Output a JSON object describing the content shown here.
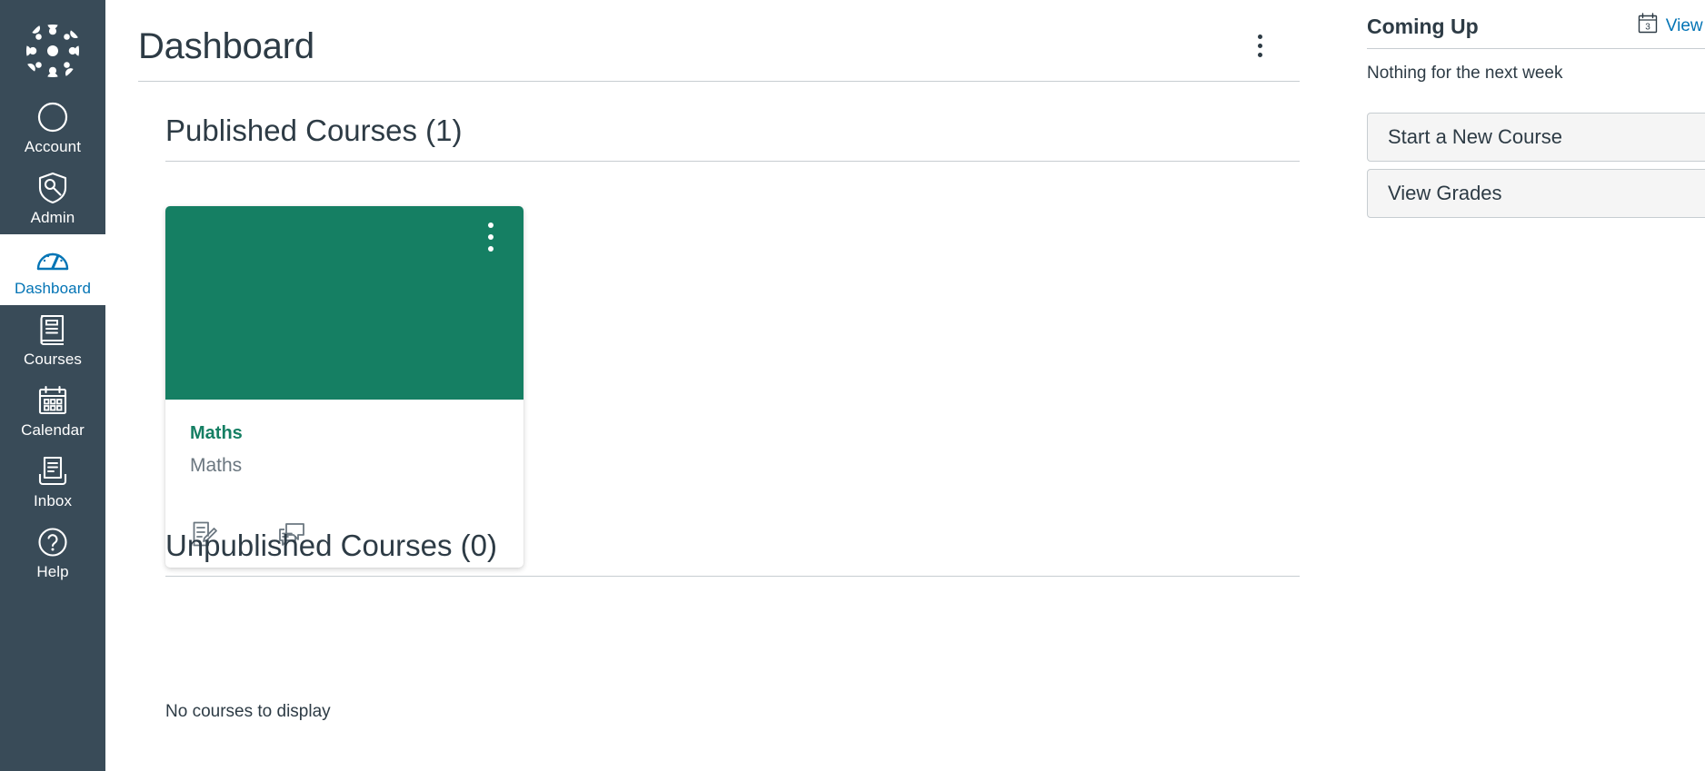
{
  "global_nav": {
    "logo_name": "canvas-logo",
    "items": [
      {
        "label": "Account",
        "icon": "user-circle-icon",
        "active": false
      },
      {
        "label": "Admin",
        "icon": "shield-key-icon",
        "active": false
      },
      {
        "label": "Dashboard",
        "icon": "dashboard-gauge-icon",
        "active": true
      },
      {
        "label": "Courses",
        "icon": "book-icon",
        "active": false
      },
      {
        "label": "Calendar",
        "icon": "calendar-icon",
        "active": false
      },
      {
        "label": "Inbox",
        "icon": "inbox-tray-icon",
        "active": false
      },
      {
        "label": "Help",
        "icon": "question-circle-icon",
        "active": false
      }
    ]
  },
  "header": {
    "title": "Dashboard",
    "options_menu_name": "dashboard-options-kebab"
  },
  "main": {
    "published_section": {
      "heading": "Published Courses (1)",
      "count": 1
    },
    "unpublished_section": {
      "heading": "Unpublished Courses (0)",
      "count": 0,
      "empty_text": "No courses to display"
    },
    "cards": [
      {
        "course_name": "Maths",
        "course_term": "Maths",
        "header_color": "#157F63",
        "link_color": "#157F63",
        "actions": [
          {
            "name": "assignments-icon",
            "label": "Assignments"
          },
          {
            "name": "discussions-icon",
            "label": "Discussions"
          }
        ]
      }
    ]
  },
  "right_sidebar": {
    "coming_up": {
      "title": "Coming Up",
      "view_calendar_label": "View Calendar",
      "calendar_icon_day": "3",
      "empty_text": "Nothing for the next week"
    },
    "buttons": [
      {
        "label": "Start a New Course",
        "name": "start-a-new-course-button"
      },
      {
        "label": "View Grades",
        "name": "view-grades-button"
      }
    ]
  },
  "colors": {
    "nav_background": "#394B58",
    "accent_link": "#0374B5",
    "course_green": "#157F63",
    "text_primary": "#2D3B45",
    "text_muted": "#6B7780",
    "divider": "#C7CDD1"
  }
}
